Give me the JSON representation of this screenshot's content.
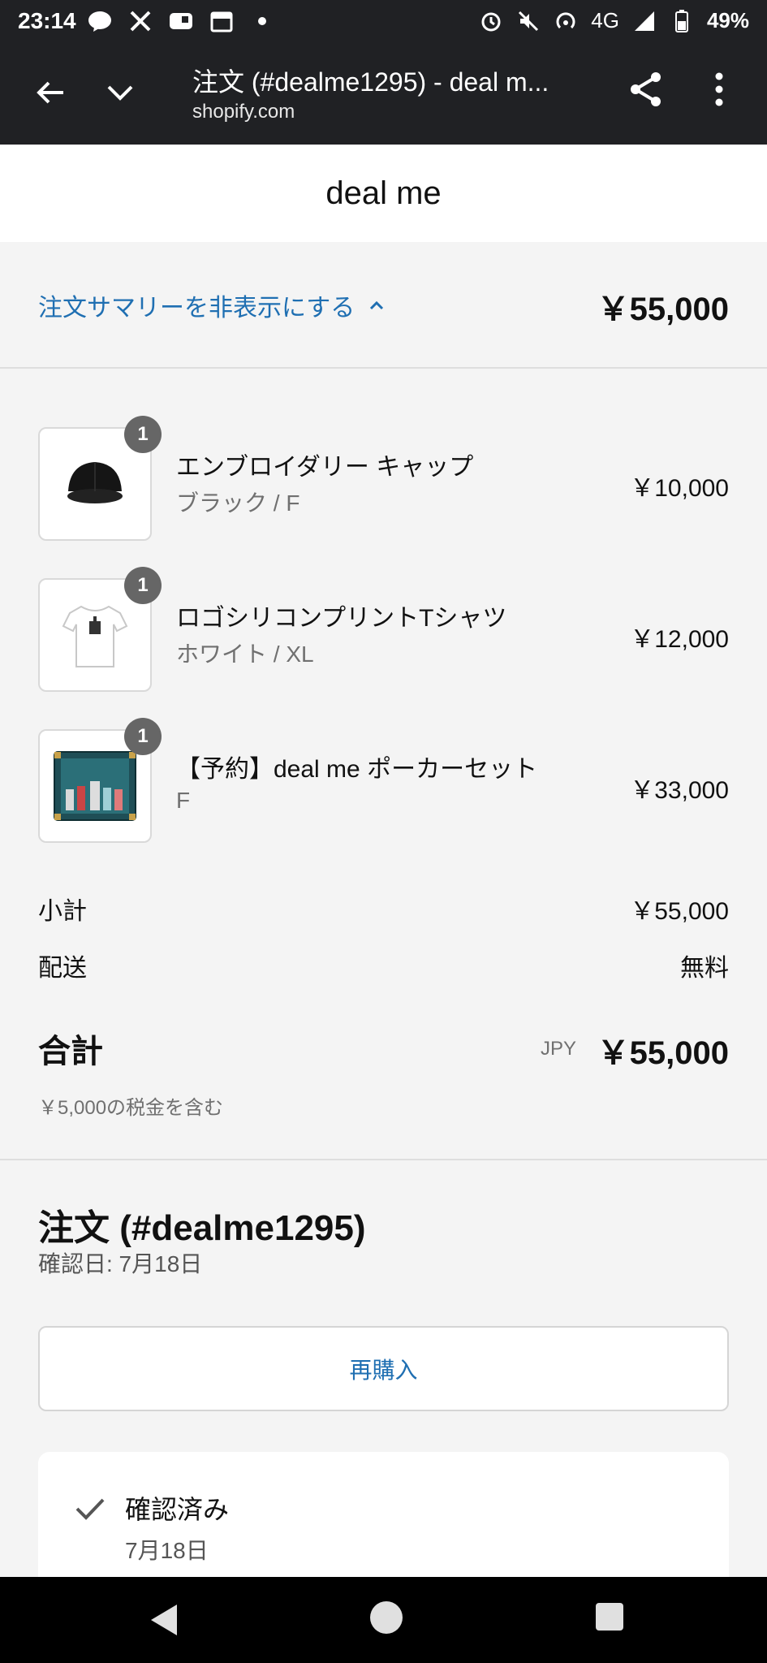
{
  "status_bar": {
    "time": "23:14",
    "network": "4G",
    "battery": "49%",
    "icons": [
      "line-icon",
      "x-icon",
      "message-icon",
      "calendar-icon",
      "dot-icon",
      "alarm-icon",
      "mute-icon",
      "hotspot-icon",
      "signal-icon",
      "battery-icon"
    ]
  },
  "browser": {
    "title": "注文 (#dealme1295) - deal m...",
    "url": "shopify.com"
  },
  "shop": {
    "name": "deal me"
  },
  "summary_toggle": {
    "label": "注文サマリーを非表示にする",
    "total": "￥55,000"
  },
  "items": [
    {
      "name": "エンブロイダリー キャップ",
      "variant": "ブラック / F",
      "price": "￥10,000",
      "qty": "1"
    },
    {
      "name": "ロゴシリコンプリントTシャツ",
      "variant": "ホワイト / XL",
      "price": "￥12,000",
      "qty": "1"
    },
    {
      "name": "【予約】deal me ポーカーセット",
      "variant": "F",
      "price": "￥33,000",
      "qty": "1"
    }
  ],
  "totals": {
    "subtotal_label": "小計",
    "subtotal": "￥55,000",
    "shipping_label": "配送",
    "shipping": "無料",
    "total_label": "合計",
    "currency": "JPY",
    "total": "￥55,000",
    "tax_note": "￥5,000の税金を含む"
  },
  "order": {
    "title": "注文 (#dealme1295)",
    "confirmed_date": "確認日: 7月18日",
    "rebuy_label": "再購入",
    "status_label": "確認済み",
    "status_date": "7月18日"
  },
  "colors": {
    "link": "#1f6fb2",
    "toolbar": "#202124"
  }
}
